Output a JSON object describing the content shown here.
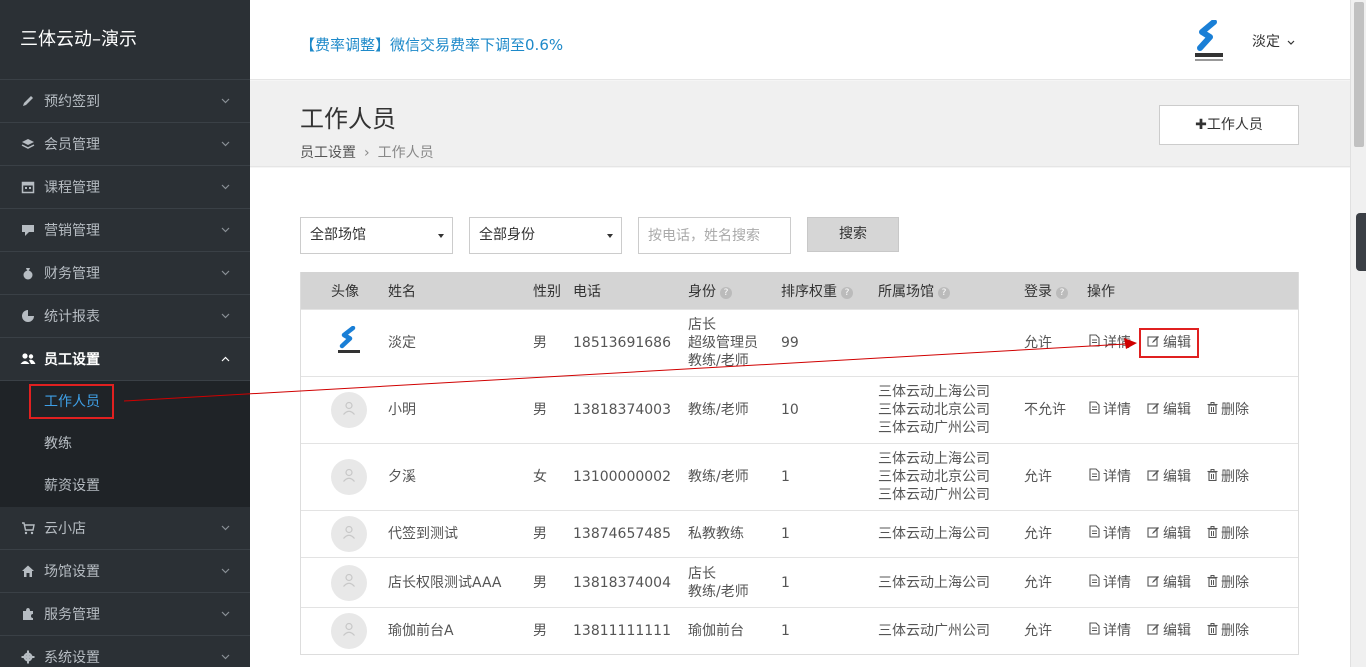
{
  "app": {
    "title": "三体云动–演示"
  },
  "sidebar": {
    "items": [
      {
        "label": "预约签到",
        "icon": "pencil-icon"
      },
      {
        "label": "会员管理",
        "icon": "layers-icon"
      },
      {
        "label": "课程管理",
        "icon": "calendar-icon"
      },
      {
        "label": "营销管理",
        "icon": "chat-icon"
      },
      {
        "label": "财务管理",
        "icon": "money-bag-icon"
      },
      {
        "label": "统计报表",
        "icon": "pie-chart-icon"
      },
      {
        "label": "员工设置",
        "icon": "users-icon"
      }
    ],
    "sub_items": [
      {
        "label": "工作人员"
      },
      {
        "label": "教练"
      },
      {
        "label": "薪资设置"
      }
    ],
    "items_after": [
      {
        "label": "云小店",
        "icon": "cart-icon"
      },
      {
        "label": "场馆设置",
        "icon": "home-icon"
      },
      {
        "label": "服务管理",
        "icon": "puzzle-icon"
      },
      {
        "label": "系统设置",
        "icon": "gear-icon"
      }
    ]
  },
  "topbar": {
    "notice": "【费率调整】微信交易费率下调至0.6%",
    "user": "淡定"
  },
  "page": {
    "title": "工作人员",
    "breadcrumb_parent": "员工设置",
    "breadcrumb_current": "工作人员",
    "add_button": "工作人员"
  },
  "filters": {
    "venue": "全部场馆",
    "role": "全部身份",
    "search_placeholder": "按电话，姓名搜索",
    "search_button": "搜索"
  },
  "table": {
    "headers": {
      "avatar": "头像",
      "name": "姓名",
      "gender": "性别",
      "phone": "电话",
      "role": "身份",
      "weight": "排序权重",
      "venue": "所属场馆",
      "login": "登录",
      "ops": "操作"
    },
    "actions": {
      "detail": "详情",
      "edit": "编辑",
      "delete": "删除"
    },
    "rows": [
      {
        "name": "淡定",
        "gender": "男",
        "phone": "18513691686",
        "roles": [
          "店长",
          "超级管理员",
          "教练/老师"
        ],
        "weight": "99",
        "venues": [],
        "login": "允许",
        "logo_avatar": true,
        "deletable": false
      },
      {
        "name": "小明",
        "gender": "男",
        "phone": "13818374003",
        "roles": [
          "教练/老师"
        ],
        "weight": "10",
        "venues": [
          "三体云动上海公司",
          "三体云动北京公司",
          "三体云动广州公司"
        ],
        "login": "不允许",
        "logo_avatar": false,
        "deletable": true
      },
      {
        "name": "夕溪",
        "gender": "女",
        "phone": "13100000002",
        "roles": [
          "教练/老师"
        ],
        "weight": "1",
        "venues": [
          "三体云动上海公司",
          "三体云动北京公司",
          "三体云动广州公司"
        ],
        "login": "允许",
        "logo_avatar": false,
        "deletable": true
      },
      {
        "name": "代签到测试",
        "gender": "男",
        "phone": "13874657485",
        "roles": [
          "私教教练"
        ],
        "weight": "1",
        "venues": [
          "三体云动上海公司"
        ],
        "login": "允许",
        "logo_avatar": false,
        "deletable": true
      },
      {
        "name": "店长权限测试AAA",
        "gender": "男",
        "phone": "13818374004",
        "roles": [
          "店长",
          "教练/老师"
        ],
        "weight": "1",
        "venues": [
          "三体云动上海公司"
        ],
        "login": "允许",
        "logo_avatar": false,
        "deletable": true
      },
      {
        "name": "瑜伽前台A",
        "gender": "男",
        "phone": "13811111111",
        "roles": [
          "瑜伽前台"
        ],
        "weight": "1",
        "venues": [
          "三体云动广州公司"
        ],
        "login": "允许",
        "logo_avatar": false,
        "deletable": true
      }
    ]
  },
  "colors": {
    "sidebar_bg": "#2b3035",
    "accent": "#1d89c9",
    "highlight": "#e02020"
  }
}
